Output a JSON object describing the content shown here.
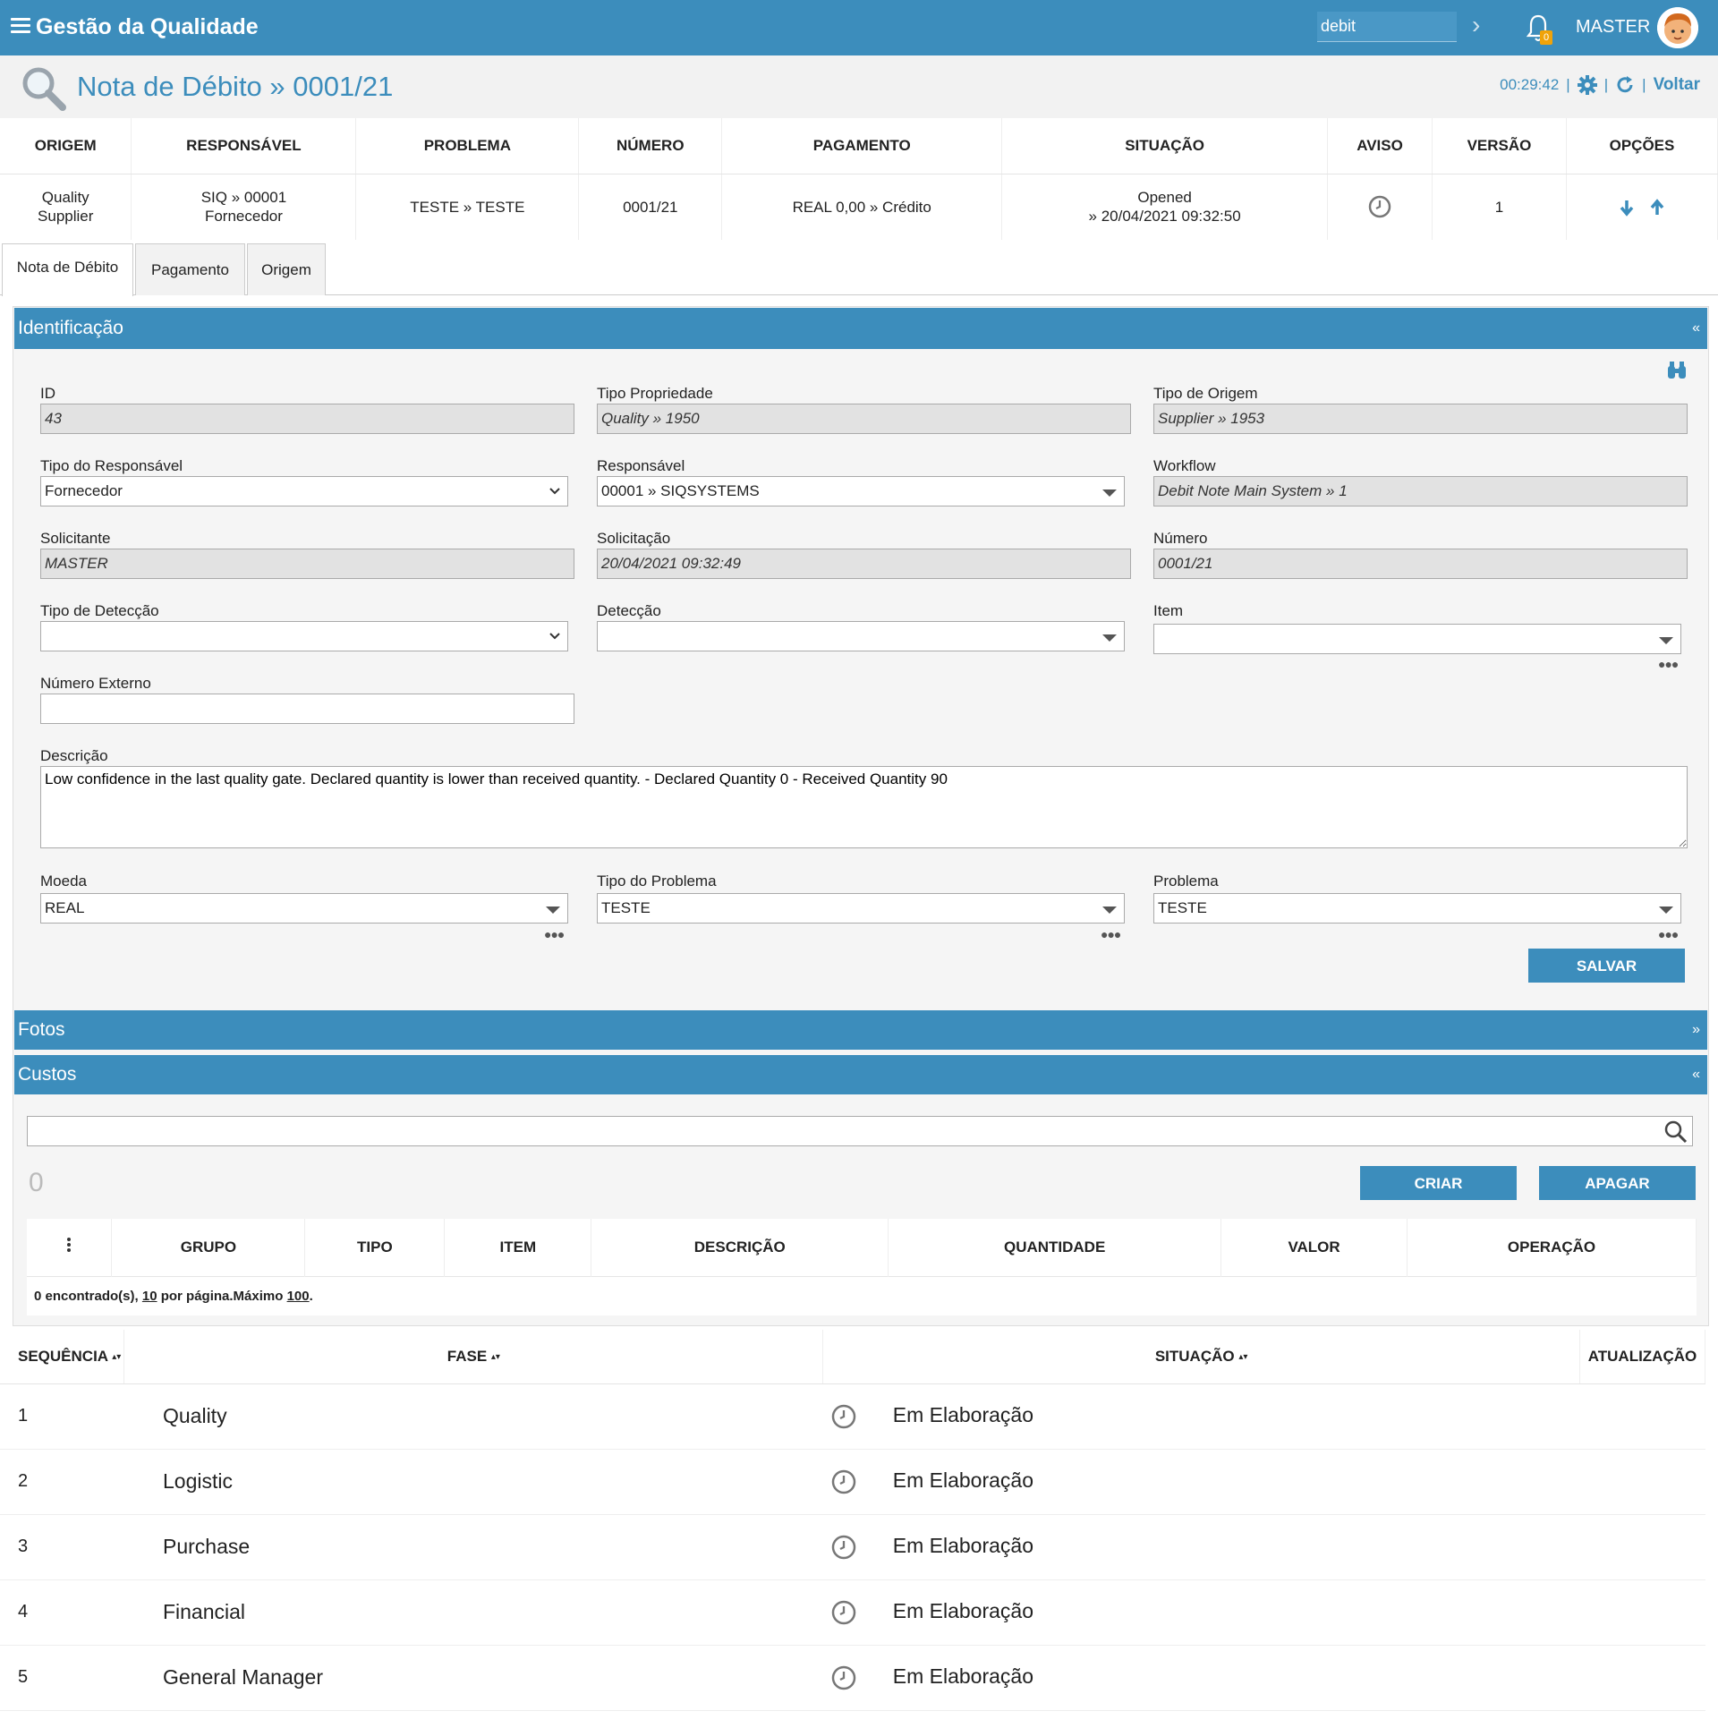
{
  "app": {
    "title": "Gestão da Qualidade",
    "search_value": "debit",
    "username": "MASTER",
    "notifications": "0"
  },
  "header": {
    "title": "Nota de Débito » 0001/21",
    "timer": "00:29:42",
    "back_label": "Voltar"
  },
  "summary": {
    "columns": [
      "ORIGEM",
      "RESPONSÁVEL",
      "PROBLEMA",
      "NÚMERO",
      "PAGAMENTO",
      "SITUAÇÃO",
      "AVISO",
      "VERSÃO",
      "OPÇÕES"
    ],
    "row": {
      "origem_1": "Quality",
      "origem_2": "Supplier",
      "responsavel_1": "SIQ » 00001",
      "responsavel_2": "Fornecedor",
      "problema": "TESTE » TESTE",
      "numero": "0001/21",
      "pagamento": "REAL 0,00 » Crédito",
      "situacao_1": "Opened",
      "situacao_2": "» 20/04/2021 09:32:50",
      "versao": "1"
    }
  },
  "tabs": [
    "Nota de Débito",
    "Pagamento",
    "Origem"
  ],
  "identificacao": {
    "title": "Identificação",
    "toggle": "«",
    "fields": {
      "id": {
        "label": "ID",
        "value": "43"
      },
      "tipo_propriedade": {
        "label": "Tipo Propriedade",
        "value": "Quality » 1950"
      },
      "tipo_origem": {
        "label": "Tipo de Origem",
        "value": "Supplier » 1953"
      },
      "tipo_responsavel": {
        "label": "Tipo do Responsável",
        "value": "Fornecedor"
      },
      "responsavel": {
        "label": "Responsável",
        "value": "00001 » SIQSYSTEMS"
      },
      "workflow": {
        "label": "Workflow",
        "value": "Debit Note Main System » 1"
      },
      "solicitante": {
        "label": "Solicitante",
        "value": "MASTER"
      },
      "solicitacao": {
        "label": "Solicitação",
        "value": "20/04/2021 09:32:49"
      },
      "numero": {
        "label": "Número",
        "value": "0001/21"
      },
      "tipo_deteccao": {
        "label": "Tipo de Detecção",
        "value": ""
      },
      "deteccao": {
        "label": "Detecção",
        "value": ""
      },
      "item": {
        "label": "Item",
        "value": ""
      },
      "numero_externo": {
        "label": "Número Externo",
        "value": ""
      },
      "descricao": {
        "label": "Descrição",
        "value": "Low confidence in the last quality gate. Declared quantity is lower than received quantity. - Declared Quantity 0 - Received Quantity 90"
      },
      "moeda": {
        "label": "Moeda",
        "value": "REAL"
      },
      "tipo_problema": {
        "label": "Tipo do Problema",
        "value": "TESTE"
      },
      "problema": {
        "label": "Problema",
        "value": "TESTE"
      }
    },
    "save_label": "SALVAR"
  },
  "fotos": {
    "title": "Fotos",
    "toggle": "»"
  },
  "custos": {
    "title": "Custos",
    "toggle": "«",
    "count": "0",
    "create_label": "CRIAR",
    "delete_label": "APAGAR",
    "columns": [
      "GRUPO",
      "TIPO",
      "ITEM",
      "DESCRIÇÃO",
      "QUANTIDADE",
      "VALOR",
      "OPERAÇÃO"
    ],
    "footer": {
      "found": "0 encontrado(s),",
      "per_page_n": "10",
      "per_page_text": "por página.Máximo",
      "max": "100",
      "end": "."
    }
  },
  "workflow_table": {
    "columns": [
      "SEQUÊNCIA",
      "FASE",
      "SITUAÇÃO",
      "ATUALIZAÇÃO"
    ],
    "rows": [
      {
        "seq": "1",
        "fase": "Quality",
        "situacao": "Em Elaboração"
      },
      {
        "seq": "2",
        "fase": "Logistic",
        "situacao": "Em Elaboração"
      },
      {
        "seq": "3",
        "fase": "Purchase",
        "situacao": "Em Elaboração"
      },
      {
        "seq": "4",
        "fase": "Financial",
        "situacao": "Em Elaboração"
      },
      {
        "seq": "5",
        "fase": "General Manager",
        "situacao": "Em Elaboração"
      }
    ]
  },
  "colors": {
    "primary": "#3c8dbc",
    "readonly_bg": "#e2e2e2",
    "badge": "#f0a30a"
  }
}
